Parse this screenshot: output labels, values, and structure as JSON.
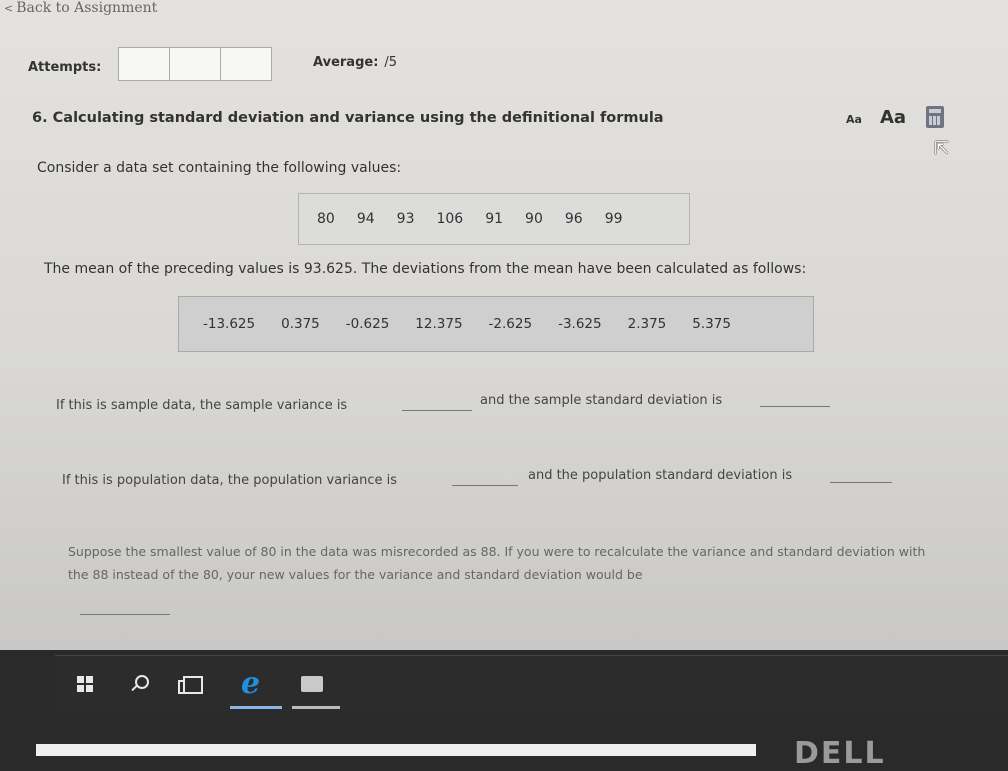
{
  "nav": {
    "back_label": "Back to Assignment",
    "back_chevron": "<"
  },
  "attempts": {
    "label": "Attempts:",
    "boxes": 3
  },
  "average": {
    "label": "Average:",
    "value": "/5"
  },
  "question": {
    "title": "6. Calculating standard deviation and variance using the definitional formula",
    "font_small": "Aa",
    "font_large": "Aa",
    "prompt": "Consider a data set containing the following values:",
    "values": [
      "80",
      "94",
      "93",
      "106",
      "91",
      "90",
      "96",
      "99"
    ],
    "mean_text": "The mean of the preceding values is 93.625. The deviations from the mean have been calculated as follows:",
    "deviations": [
      "-13.625",
      "0.375",
      "-0.625",
      "12.375",
      "-2.625",
      "-3.625",
      "2.375",
      "5.375"
    ],
    "sample_variance_label": "If this is sample data, the sample variance is",
    "sample_sd_label": "and the sample standard deviation is",
    "population_variance_label": "If this is population data, the population variance is",
    "population_sd_label": "and the population standard deviation is",
    "suppose_text": "Suppose the smallest value of 80 in the data was misrecorded as 88. If you were to recalculate the variance and standard deviation with the 88 instead of the 80, your new values for the variance and standard deviation would be"
  },
  "icons": [
    "calculator-icon",
    "cursor-icon",
    "windows-start-icon",
    "search-icon",
    "task-view-icon",
    "edge-browser-icon",
    "app-icon"
  ],
  "bezel": {
    "brand": "DELL"
  }
}
